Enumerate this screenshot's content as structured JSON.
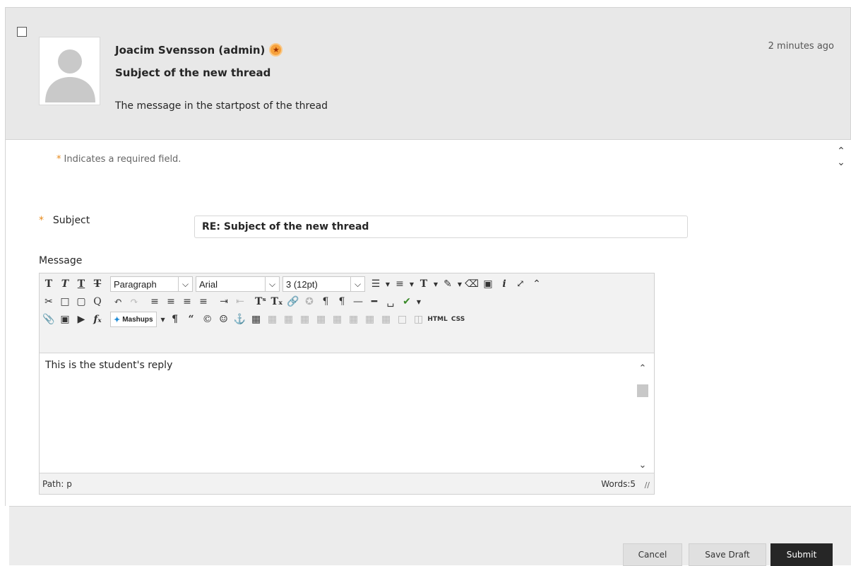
{
  "post": {
    "author": "Joacim Svensson (admin)",
    "subject": "Subject of the new thread",
    "message": "The message in the startpost of the thread",
    "time": "2 minutes ago"
  },
  "form": {
    "required_note": "Indicates a required field.",
    "required_marker": "*",
    "subject_label": "Subject",
    "subject_value": "RE: Subject of the new thread",
    "message_label": "Message"
  },
  "editor": {
    "format_select": "Paragraph",
    "font_select": "Arial",
    "size_select": "3 (12pt)",
    "mashups_label": "Mashups",
    "html_label": "HTML",
    "css_label": "CSS",
    "content": "This is the student's reply",
    "path_label": "Path: p",
    "word_count": "Words:5"
  },
  "buttons": {
    "cancel": "Cancel",
    "save_draft": "Save Draft",
    "submit": "Submit"
  },
  "colors": {
    "required_star": "#e88a1a",
    "submit_bg": "#262626",
    "badge": "#f7a23c"
  }
}
